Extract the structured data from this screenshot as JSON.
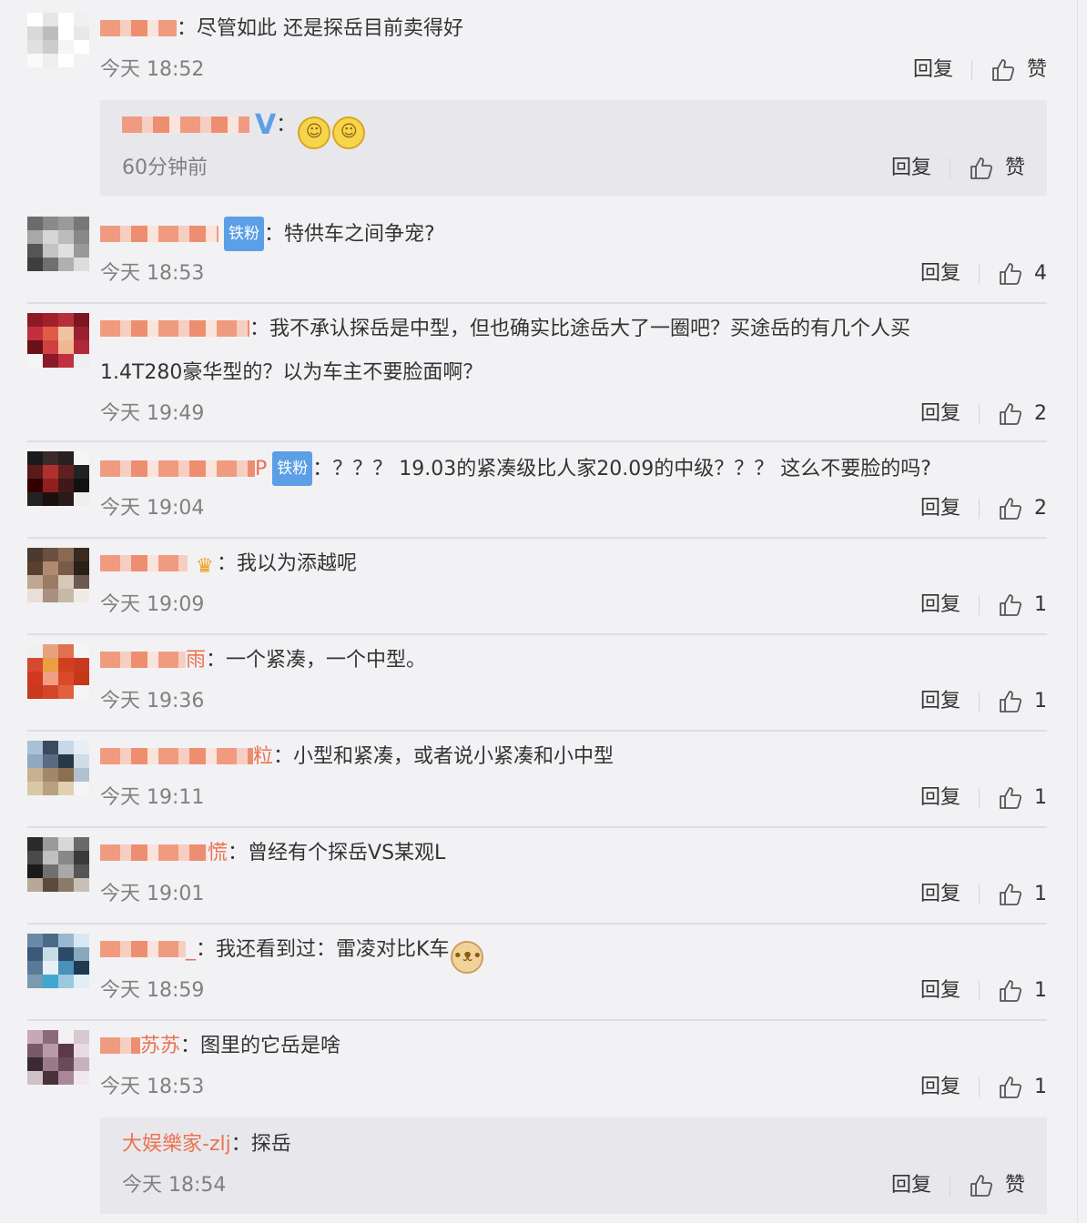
{
  "labels": {
    "reply": "回复",
    "like": "赞"
  },
  "comments": [
    {
      "nick": "",
      "text": "尽管如此 还是探岳目前卖得好",
      "time": "今天 18:52",
      "likes": "赞"
    },
    {
      "nick": "",
      "text": "特供车之间争宠?",
      "badge": "铁粉",
      "time": "今天 18:53",
      "likes": "4"
    },
    {
      "nick": "",
      "text": "我不承认探岳是中型，但也确实比途岳大了一圈吧？买途岳的有几个人买",
      "text2": "1.4T280豪华型的？以为车主不要脸面啊？",
      "time": "今天 19:49",
      "likes": "2"
    },
    {
      "nick": "",
      "nick_tail": "P",
      "badge": "铁粉",
      "text": "？？？ 19.03的紧凑级比人家20.09的中级？？？ 这么不要脸的吗?",
      "time": "今天 19:04",
      "likes": "2"
    },
    {
      "nick": "",
      "text": "我以为添越呢",
      "time": "今天 19:09",
      "likes": "1"
    },
    {
      "nick": "",
      "nick_tail": "雨",
      "text": "一个紧凑，一个中型。",
      "time": "今天 19:36",
      "likes": "1"
    },
    {
      "nick": "",
      "nick_tail": "粒",
      "text": "小型和紧凑，或者说小紧凑和小中型",
      "time": "今天 19:11",
      "likes": "1"
    },
    {
      "nick": "",
      "nick_tail": "慌",
      "text": "曾经有个探岳VS某观L",
      "time": "今天 19:01",
      "likes": "1"
    },
    {
      "nick": "",
      "nick_tail": "_",
      "text": "我还看到过：雷凌对比K车",
      "time": "今天 18:59",
      "likes": "1"
    },
    {
      "nick": "",
      "nick_tail": "苏苏",
      "text": "图里的它岳是啥",
      "time": "今天 18:53",
      "likes": "1"
    }
  ],
  "subreplies": [
    {
      "nick": "",
      "text": "",
      "time": "60分钟前",
      "likes": "赞"
    },
    {
      "nick": "大娱樂家-zlj",
      "text": "探岳",
      "time": "今天 18:54",
      "likes": "赞"
    }
  ],
  "colors": {
    "nick": "#eb7350",
    "badge": "#5b9fe6",
    "time": "#808080",
    "divider": "#dedee2"
  }
}
